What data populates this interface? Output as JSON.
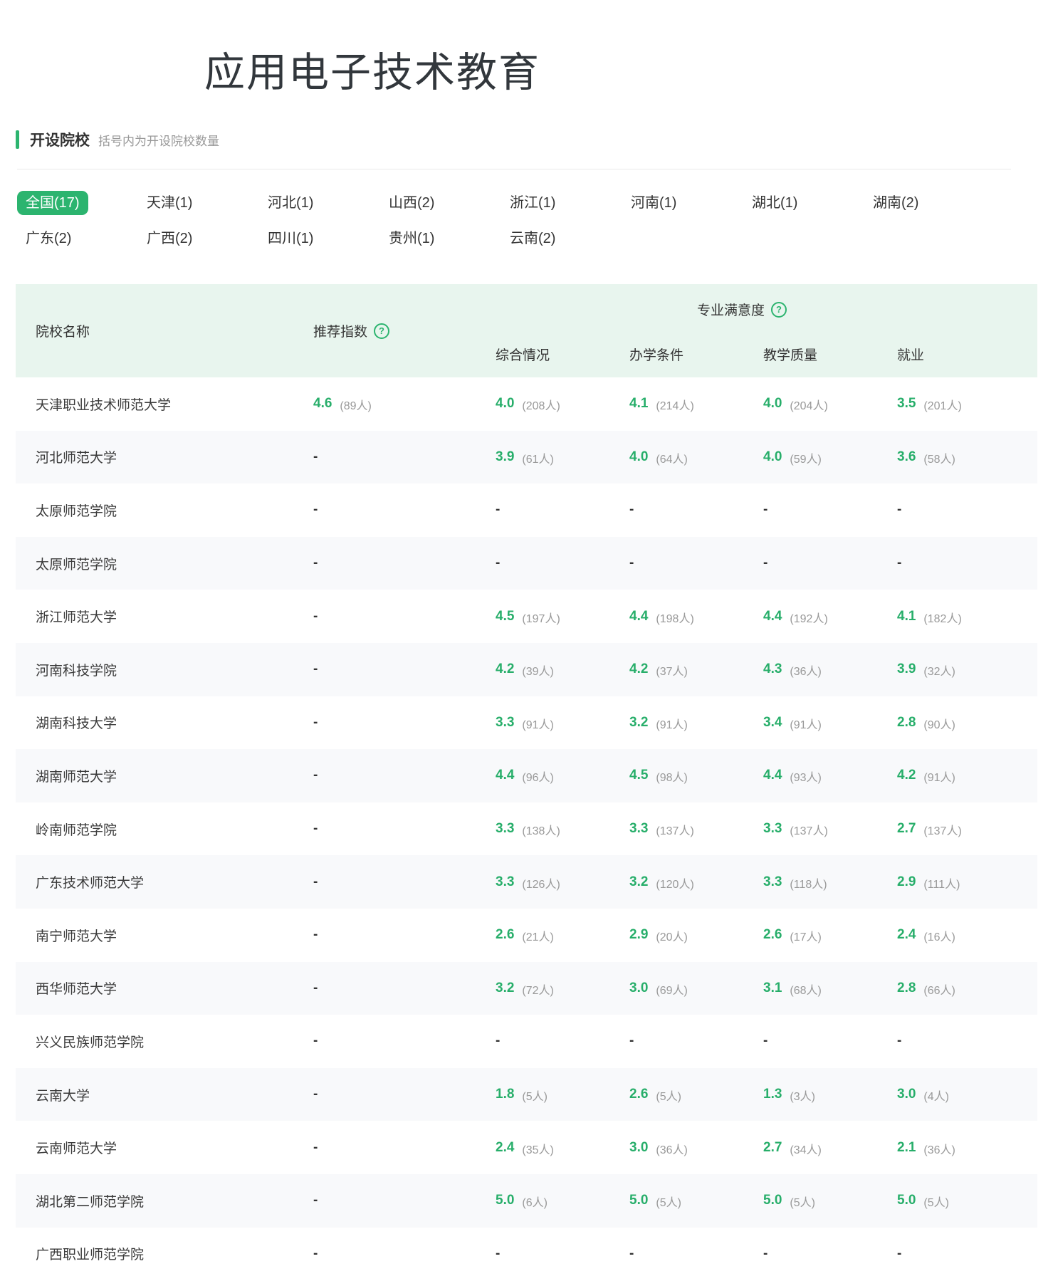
{
  "page": {
    "title": "应用电子技术教育"
  },
  "section": {
    "title": "开设院校",
    "subtitle": "括号内为开设院校数量"
  },
  "icons": {
    "help": "?"
  },
  "colors": {
    "accent_green": "#2CB46F",
    "score_green": "#27AE6A",
    "header_bg": "#E8F5EE",
    "alt_row_bg": "#F8F9FB",
    "muted_text": "#999999",
    "dark_text": "#333333"
  },
  "filters": {
    "tabs": [
      {
        "label": "全国(17)",
        "active": true
      },
      {
        "label": "天津(1)",
        "active": false
      },
      {
        "label": "河北(1)",
        "active": false
      },
      {
        "label": "山西(2)",
        "active": false
      },
      {
        "label": "浙江(1)",
        "active": false
      },
      {
        "label": "河南(1)",
        "active": false
      },
      {
        "label": "湖北(1)",
        "active": false
      },
      {
        "label": "湖南(2)",
        "active": false
      },
      {
        "label": "广东(2)",
        "active": false
      },
      {
        "label": "广西(2)",
        "active": false
      },
      {
        "label": "四川(1)",
        "active": false
      },
      {
        "label": "贵州(1)",
        "active": false
      },
      {
        "label": "云南(2)",
        "active": false
      }
    ]
  },
  "table": {
    "dash": "-",
    "headers": {
      "school": "院校名称",
      "recommend": "推荐指数",
      "satisfaction": "专业满意度",
      "sub": [
        "综合情况",
        "办学条件",
        "教学质量",
        "就业"
      ]
    },
    "rows": [
      {
        "school": "天津职业技术师范大学",
        "recommend": {
          "score": "4.6",
          "count": "(89人)"
        },
        "metrics": [
          {
            "score": "4.0",
            "count": "(208人)"
          },
          {
            "score": "4.1",
            "count": "(214人)"
          },
          {
            "score": "4.0",
            "count": "(204人)"
          },
          {
            "score": "3.5",
            "count": "(201人)"
          }
        ]
      },
      {
        "school": "河北师范大学",
        "recommend": null,
        "metrics": [
          {
            "score": "3.9",
            "count": "(61人)"
          },
          {
            "score": "4.0",
            "count": "(64人)"
          },
          {
            "score": "4.0",
            "count": "(59人)"
          },
          {
            "score": "3.6",
            "count": "(58人)"
          }
        ]
      },
      {
        "school": "太原师范学院",
        "recommend": null,
        "metrics": [
          null,
          null,
          null,
          null
        ]
      },
      {
        "school": "太原师范学院",
        "recommend": null,
        "metrics": [
          null,
          null,
          null,
          null
        ]
      },
      {
        "school": "浙江师范大学",
        "recommend": null,
        "metrics": [
          {
            "score": "4.5",
            "count": "(197人)"
          },
          {
            "score": "4.4",
            "count": "(198人)"
          },
          {
            "score": "4.4",
            "count": "(192人)"
          },
          {
            "score": "4.1",
            "count": "(182人)"
          }
        ]
      },
      {
        "school": "河南科技学院",
        "recommend": null,
        "metrics": [
          {
            "score": "4.2",
            "count": "(39人)"
          },
          {
            "score": "4.2",
            "count": "(37人)"
          },
          {
            "score": "4.3",
            "count": "(36人)"
          },
          {
            "score": "3.9",
            "count": "(32人)"
          }
        ]
      },
      {
        "school": "湖南科技大学",
        "recommend": null,
        "metrics": [
          {
            "score": "3.3",
            "count": "(91人)"
          },
          {
            "score": "3.2",
            "count": "(91人)"
          },
          {
            "score": "3.4",
            "count": "(91人)"
          },
          {
            "score": "2.8",
            "count": "(90人)"
          }
        ]
      },
      {
        "school": "湖南师范大学",
        "recommend": null,
        "metrics": [
          {
            "score": "4.4",
            "count": "(96人)"
          },
          {
            "score": "4.5",
            "count": "(98人)"
          },
          {
            "score": "4.4",
            "count": "(93人)"
          },
          {
            "score": "4.2",
            "count": "(91人)"
          }
        ]
      },
      {
        "school": "岭南师范学院",
        "recommend": null,
        "metrics": [
          {
            "score": "3.3",
            "count": "(138人)"
          },
          {
            "score": "3.3",
            "count": "(137人)"
          },
          {
            "score": "3.3",
            "count": "(137人)"
          },
          {
            "score": "2.7",
            "count": "(137人)"
          }
        ]
      },
      {
        "school": "广东技术师范大学",
        "recommend": null,
        "metrics": [
          {
            "score": "3.3",
            "count": "(126人)"
          },
          {
            "score": "3.2",
            "count": "(120人)"
          },
          {
            "score": "3.3",
            "count": "(118人)"
          },
          {
            "score": "2.9",
            "count": "(111人)"
          }
        ]
      },
      {
        "school": "南宁师范大学",
        "recommend": null,
        "metrics": [
          {
            "score": "2.6",
            "count": "(21人)"
          },
          {
            "score": "2.9",
            "count": "(20人)"
          },
          {
            "score": "2.6",
            "count": "(17人)"
          },
          {
            "score": "2.4",
            "count": "(16人)"
          }
        ]
      },
      {
        "school": "西华师范大学",
        "recommend": null,
        "metrics": [
          {
            "score": "3.2",
            "count": "(72人)"
          },
          {
            "score": "3.0",
            "count": "(69人)"
          },
          {
            "score": "3.1",
            "count": "(68人)"
          },
          {
            "score": "2.8",
            "count": "(66人)"
          }
        ]
      },
      {
        "school": "兴义民族师范学院",
        "recommend": null,
        "metrics": [
          null,
          null,
          null,
          null
        ]
      },
      {
        "school": "云南大学",
        "recommend": null,
        "metrics": [
          {
            "score": "1.8",
            "count": "(5人)"
          },
          {
            "score": "2.6",
            "count": "(5人)"
          },
          {
            "score": "1.3",
            "count": "(3人)"
          },
          {
            "score": "3.0",
            "count": "(4人)"
          }
        ]
      },
      {
        "school": "云南师范大学",
        "recommend": null,
        "metrics": [
          {
            "score": "2.4",
            "count": "(35人)"
          },
          {
            "score": "3.0",
            "count": "(36人)"
          },
          {
            "score": "2.7",
            "count": "(34人)"
          },
          {
            "score": "2.1",
            "count": "(36人)"
          }
        ]
      },
      {
        "school": "湖北第二师范学院",
        "recommend": null,
        "metrics": [
          {
            "score": "5.0",
            "count": "(6人)"
          },
          {
            "score": "5.0",
            "count": "(5人)"
          },
          {
            "score": "5.0",
            "count": "(5人)"
          },
          {
            "score": "5.0",
            "count": "(5人)"
          }
        ]
      },
      {
        "school": "广西职业师范学院",
        "recommend": null,
        "metrics": [
          null,
          null,
          null,
          null
        ]
      }
    ]
  }
}
